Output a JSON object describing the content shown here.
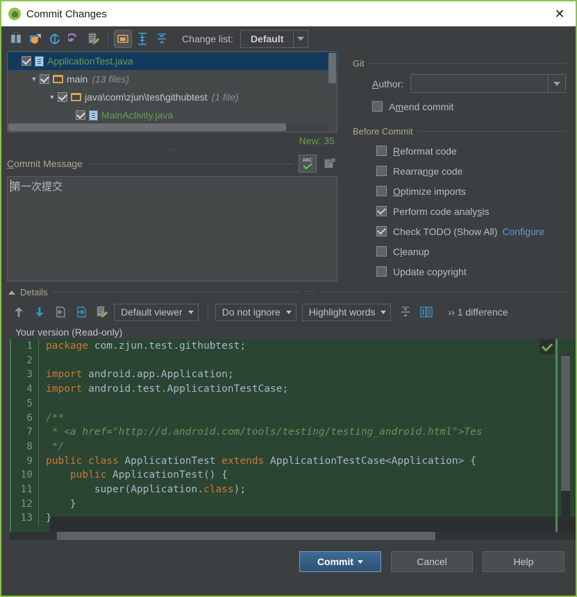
{
  "window": {
    "title": "Commit Changes",
    "app_icon": "android-icon",
    "close_label": "✕",
    "border_color": "#8bc34a"
  },
  "toolbar": {
    "icons": [
      {
        "name": "show-diff-icon",
        "title": "Show Diff"
      },
      {
        "name": "move-to-changelist-icon",
        "title": "Move to Another Changelist"
      },
      {
        "name": "refresh-icon",
        "title": "Refresh Changes"
      },
      {
        "name": "revert-icon",
        "title": "Revert"
      },
      {
        "name": "edit-source-icon",
        "title": "Edit Source"
      },
      {
        "name": "group-by-directory-icon",
        "title": "Group by Directory",
        "active": true
      },
      {
        "name": "expand-all-icon",
        "title": "Expand All"
      },
      {
        "name": "collapse-all-icon",
        "title": "Collapse All"
      }
    ],
    "changelist_label": "Change list:",
    "changelist_value": "Default"
  },
  "file_tree": {
    "rows": [
      {
        "indent": 0,
        "twisty": "",
        "checked": true,
        "icon": "java-file-icon",
        "name": "ApplicationTest.java",
        "meta": "",
        "kind": "file",
        "selected": true
      },
      {
        "indent": 1,
        "twisty": "▼",
        "checked": true,
        "icon": "folder-icon",
        "name": "main",
        "meta": "(13 files)",
        "kind": "dir",
        "selected": false
      },
      {
        "indent": 2,
        "twisty": "▼",
        "checked": true,
        "icon": "folder-icon",
        "name": "java\\com\\zjun\\test\\githubtest",
        "meta": "(1 file)",
        "kind": "dir",
        "selected": false
      },
      {
        "indent": 3,
        "twisty": "",
        "checked": true,
        "icon": "java-file-icon",
        "name": "MainActivity.java",
        "meta": "",
        "kind": "file",
        "selected": false
      }
    ],
    "new_count": "New: 35"
  },
  "commit_message": {
    "label": "Commit Message",
    "label_accel": "C",
    "value": "第一次提交",
    "spellcheck_icon": "abc-spellcheck-icon",
    "history_icon": "message-history-icon"
  },
  "git_section": {
    "title": "Git",
    "author_label": "Author:",
    "author_accel": "A",
    "author_value": "",
    "amend": {
      "label": "Amend commit",
      "accel": "m",
      "checked": false
    }
  },
  "before_commit": {
    "title": "Before Commit",
    "items": [
      {
        "label": "Reformat code",
        "accel": "R",
        "checked": false,
        "name": "reformat-code"
      },
      {
        "label": "Rearrange code",
        "accel": "n",
        "checked": false,
        "name": "rearrange-code"
      },
      {
        "label": "Optimize imports",
        "accel": "O",
        "checked": false,
        "name": "optimize-imports"
      },
      {
        "label": "Perform code analysis",
        "accel": "s",
        "checked": true,
        "name": "perform-code-analysis"
      },
      {
        "label": "Check TODO (Show All)",
        "accel": "",
        "checked": true,
        "name": "check-todo",
        "link": "Configure"
      },
      {
        "label": "Cleanup",
        "accel": "l",
        "checked": false,
        "name": "cleanup"
      },
      {
        "label": "Update copyright",
        "accel": "",
        "checked": false,
        "name": "update-copyright"
      }
    ]
  },
  "details": {
    "title": "Details",
    "toolbar_icons": [
      {
        "name": "previous-difference-icon"
      },
      {
        "name": "next-difference-icon"
      },
      {
        "name": "apply-left-icon"
      },
      {
        "name": "apply-right-icon"
      },
      {
        "name": "edit-source-icon"
      }
    ],
    "viewer_select": "Default viewer",
    "ignore_select": "Do not ignore",
    "highlight_select": "Highlight words",
    "collapse_icon": "collapse-unchanged-icon",
    "sync_scroll_icon": "synchronize-scrolling-icon",
    "difference_count": "›› 1 difference",
    "pane_title": "Your version (Read-only)"
  },
  "code": {
    "lines": [
      {
        "num": "1",
        "tokens": [
          {
            "t": "package",
            "c": "k"
          },
          {
            "t": " com.zjun.test.githubtest;",
            "c": "n"
          }
        ]
      },
      {
        "num": "2",
        "tokens": [
          {
            "t": "",
            "c": "n"
          }
        ]
      },
      {
        "num": "3",
        "tokens": [
          {
            "t": "import",
            "c": "k"
          },
          {
            "t": " android.app.Application;",
            "c": "n"
          }
        ]
      },
      {
        "num": "4",
        "tokens": [
          {
            "t": "import",
            "c": "k"
          },
          {
            "t": " android.test.ApplicationTestCase;",
            "c": "n"
          }
        ]
      },
      {
        "num": "5",
        "tokens": [
          {
            "t": "",
            "c": "n"
          }
        ]
      },
      {
        "num": "6",
        "tokens": [
          {
            "t": "/**",
            "c": "c"
          }
        ]
      },
      {
        "num": "7",
        "tokens": [
          {
            "t": " * <a href=\"http://d.android.com/tools/testing/testing_android.html\">Tes",
            "c": "c"
          }
        ]
      },
      {
        "num": "8",
        "tokens": [
          {
            "t": " */",
            "c": "c"
          }
        ]
      },
      {
        "num": "9",
        "tokens": [
          {
            "t": "public class",
            "c": "k"
          },
          {
            "t": " ApplicationTest ",
            "c": "n"
          },
          {
            "t": "extends",
            "c": "k"
          },
          {
            "t": " ApplicationTestCase<Application> {",
            "c": "n"
          }
        ]
      },
      {
        "num": "10",
        "tokens": [
          {
            "t": "    public",
            "c": "k"
          },
          {
            "t": " ApplicationTest() {",
            "c": "n"
          }
        ]
      },
      {
        "num": "11",
        "tokens": [
          {
            "t": "        super(Application.",
            "c": "n"
          },
          {
            "t": "class",
            "c": "k"
          },
          {
            "t": ");",
            "c": "n"
          }
        ]
      },
      {
        "num": "12",
        "tokens": [
          {
            "t": "    }",
            "c": "n"
          }
        ]
      },
      {
        "num": "13",
        "tokens": [
          {
            "t": "}",
            "c": "n"
          }
        ]
      }
    ]
  },
  "buttons": {
    "commit": "Commit",
    "commit_accel": "t",
    "cancel": "Cancel",
    "help": "Help"
  },
  "colors": {
    "accent_blue": "#5b9bd5",
    "added_green": "#2b4533",
    "selection": "#123a5c",
    "window_border": "#8bc34a"
  }
}
